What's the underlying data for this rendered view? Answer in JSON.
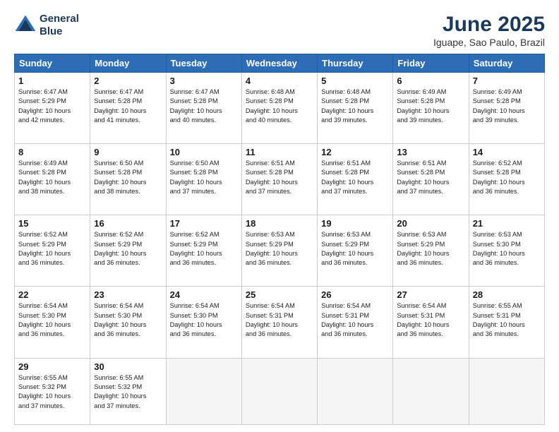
{
  "header": {
    "logo_line1": "General",
    "logo_line2": "Blue",
    "month": "June 2025",
    "location": "Iguape, Sao Paulo, Brazil"
  },
  "weekdays": [
    "Sunday",
    "Monday",
    "Tuesday",
    "Wednesday",
    "Thursday",
    "Friday",
    "Saturday"
  ],
  "weeks": [
    [
      {
        "day": "1",
        "info": "Sunrise: 6:47 AM\nSunset: 5:29 PM\nDaylight: 10 hours\nand 42 minutes."
      },
      {
        "day": "2",
        "info": "Sunrise: 6:47 AM\nSunset: 5:28 PM\nDaylight: 10 hours\nand 41 minutes."
      },
      {
        "day": "3",
        "info": "Sunrise: 6:47 AM\nSunset: 5:28 PM\nDaylight: 10 hours\nand 40 minutes."
      },
      {
        "day": "4",
        "info": "Sunrise: 6:48 AM\nSunset: 5:28 PM\nDaylight: 10 hours\nand 40 minutes."
      },
      {
        "day": "5",
        "info": "Sunrise: 6:48 AM\nSunset: 5:28 PM\nDaylight: 10 hours\nand 39 minutes."
      },
      {
        "day": "6",
        "info": "Sunrise: 6:49 AM\nSunset: 5:28 PM\nDaylight: 10 hours\nand 39 minutes."
      },
      {
        "day": "7",
        "info": "Sunrise: 6:49 AM\nSunset: 5:28 PM\nDaylight: 10 hours\nand 39 minutes."
      }
    ],
    [
      {
        "day": "8",
        "info": "Sunrise: 6:49 AM\nSunset: 5:28 PM\nDaylight: 10 hours\nand 38 minutes."
      },
      {
        "day": "9",
        "info": "Sunrise: 6:50 AM\nSunset: 5:28 PM\nDaylight: 10 hours\nand 38 minutes."
      },
      {
        "day": "10",
        "info": "Sunrise: 6:50 AM\nSunset: 5:28 PM\nDaylight: 10 hours\nand 37 minutes."
      },
      {
        "day": "11",
        "info": "Sunrise: 6:51 AM\nSunset: 5:28 PM\nDaylight: 10 hours\nand 37 minutes."
      },
      {
        "day": "12",
        "info": "Sunrise: 6:51 AM\nSunset: 5:28 PM\nDaylight: 10 hours\nand 37 minutes."
      },
      {
        "day": "13",
        "info": "Sunrise: 6:51 AM\nSunset: 5:28 PM\nDaylight: 10 hours\nand 37 minutes."
      },
      {
        "day": "14",
        "info": "Sunrise: 6:52 AM\nSunset: 5:28 PM\nDaylight: 10 hours\nand 36 minutes."
      }
    ],
    [
      {
        "day": "15",
        "info": "Sunrise: 6:52 AM\nSunset: 5:29 PM\nDaylight: 10 hours\nand 36 minutes."
      },
      {
        "day": "16",
        "info": "Sunrise: 6:52 AM\nSunset: 5:29 PM\nDaylight: 10 hours\nand 36 minutes."
      },
      {
        "day": "17",
        "info": "Sunrise: 6:52 AM\nSunset: 5:29 PM\nDaylight: 10 hours\nand 36 minutes."
      },
      {
        "day": "18",
        "info": "Sunrise: 6:53 AM\nSunset: 5:29 PM\nDaylight: 10 hours\nand 36 minutes."
      },
      {
        "day": "19",
        "info": "Sunrise: 6:53 AM\nSunset: 5:29 PM\nDaylight: 10 hours\nand 36 minutes."
      },
      {
        "day": "20",
        "info": "Sunrise: 6:53 AM\nSunset: 5:29 PM\nDaylight: 10 hours\nand 36 minutes."
      },
      {
        "day": "21",
        "info": "Sunrise: 6:53 AM\nSunset: 5:30 PM\nDaylight: 10 hours\nand 36 minutes."
      }
    ],
    [
      {
        "day": "22",
        "info": "Sunrise: 6:54 AM\nSunset: 5:30 PM\nDaylight: 10 hours\nand 36 minutes."
      },
      {
        "day": "23",
        "info": "Sunrise: 6:54 AM\nSunset: 5:30 PM\nDaylight: 10 hours\nand 36 minutes."
      },
      {
        "day": "24",
        "info": "Sunrise: 6:54 AM\nSunset: 5:30 PM\nDaylight: 10 hours\nand 36 minutes."
      },
      {
        "day": "25",
        "info": "Sunrise: 6:54 AM\nSunset: 5:31 PM\nDaylight: 10 hours\nand 36 minutes."
      },
      {
        "day": "26",
        "info": "Sunrise: 6:54 AM\nSunset: 5:31 PM\nDaylight: 10 hours\nand 36 minutes."
      },
      {
        "day": "27",
        "info": "Sunrise: 6:54 AM\nSunset: 5:31 PM\nDaylight: 10 hours\nand 36 minutes."
      },
      {
        "day": "28",
        "info": "Sunrise: 6:55 AM\nSunset: 5:31 PM\nDaylight: 10 hours\nand 36 minutes."
      }
    ],
    [
      {
        "day": "29",
        "info": "Sunrise: 6:55 AM\nSunset: 5:32 PM\nDaylight: 10 hours\nand 37 minutes."
      },
      {
        "day": "30",
        "info": "Sunrise: 6:55 AM\nSunset: 5:32 PM\nDaylight: 10 hours\nand 37 minutes."
      },
      {
        "day": "",
        "info": ""
      },
      {
        "day": "",
        "info": ""
      },
      {
        "day": "",
        "info": ""
      },
      {
        "day": "",
        "info": ""
      },
      {
        "day": "",
        "info": ""
      }
    ]
  ]
}
